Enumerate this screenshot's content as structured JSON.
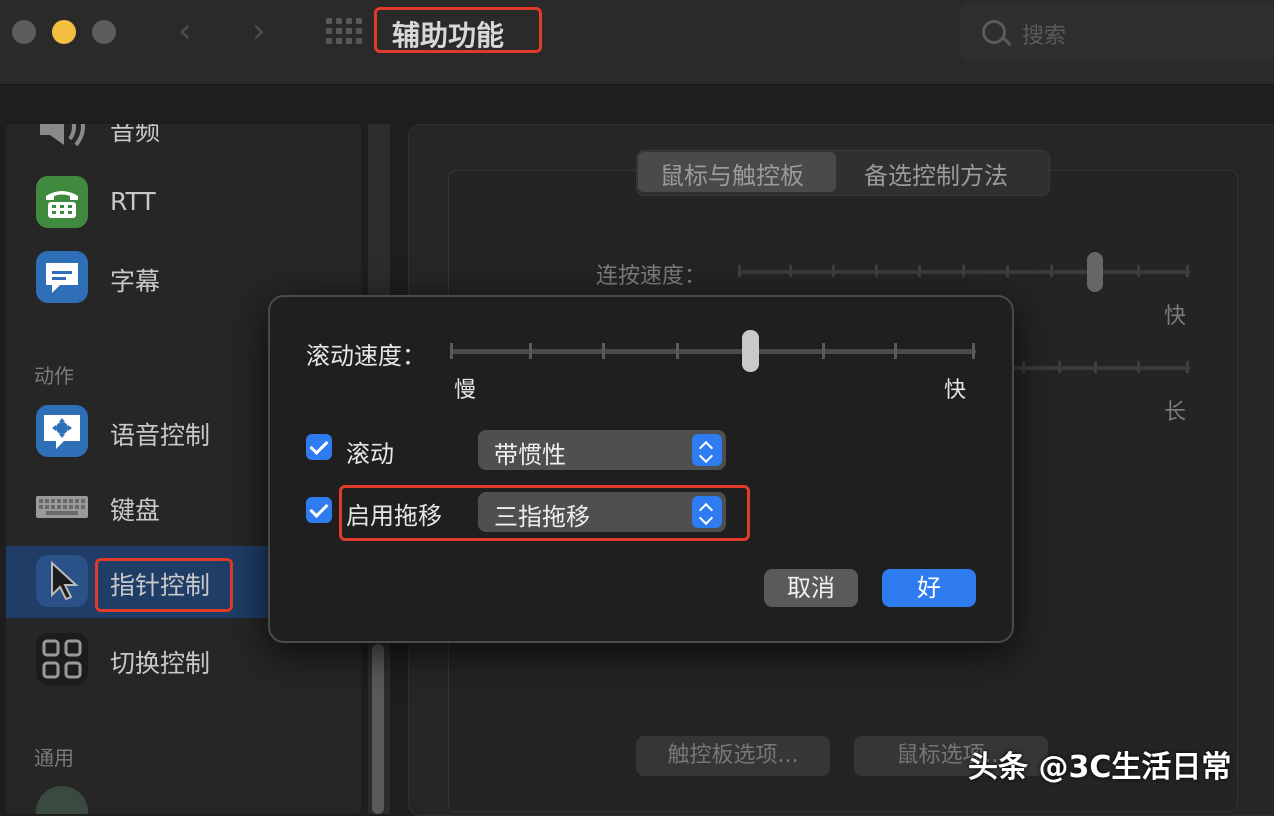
{
  "window": {
    "title": "辅助功能"
  },
  "search": {
    "placeholder": "搜索"
  },
  "sidebar": {
    "items": [
      {
        "label": "音频",
        "icon": "speaker-icon"
      },
      {
        "label": "RTT",
        "icon": "telephone-icon"
      },
      {
        "label": "字幕",
        "icon": "captions-icon"
      },
      {
        "label": "语音控制",
        "icon": "voice-control-icon"
      },
      {
        "label": "键盘",
        "icon": "keyboard-icon"
      },
      {
        "label": "指针控制",
        "icon": "pointer-icon",
        "selected": true
      },
      {
        "label": "切换控制",
        "icon": "switch-control-icon"
      }
    ],
    "sections": {
      "actions": "动作",
      "general": "通用"
    }
  },
  "main": {
    "tabs": [
      {
        "label": "鼠标与触控板",
        "selected": true
      },
      {
        "label": "备选控制方法"
      }
    ],
    "double_click_speed_label": "连按速度：",
    "fast_label": "快",
    "long_label": "长",
    "trackpad_options_button": "触控板选项...",
    "mouse_options_button": "鼠标选项..."
  },
  "dialog": {
    "scroll_speed_label": "滚动速度：",
    "scroll_speed_value": 0.57,
    "slow_label": "慢",
    "fast_label": "快",
    "scroll_checkbox_label": "滚动",
    "scroll_checked": true,
    "scroll_select_value": "带惯性",
    "drag_checkbox_label": "启用拖移",
    "drag_checked": true,
    "drag_select_value": "三指拖移",
    "cancel_button": "取消",
    "ok_button": "好"
  },
  "colors": {
    "accent": "#2f7bf0",
    "highlight": "#e03a2a",
    "selection": "#1f3d66"
  },
  "watermark": "头条 @3C生活日常"
}
